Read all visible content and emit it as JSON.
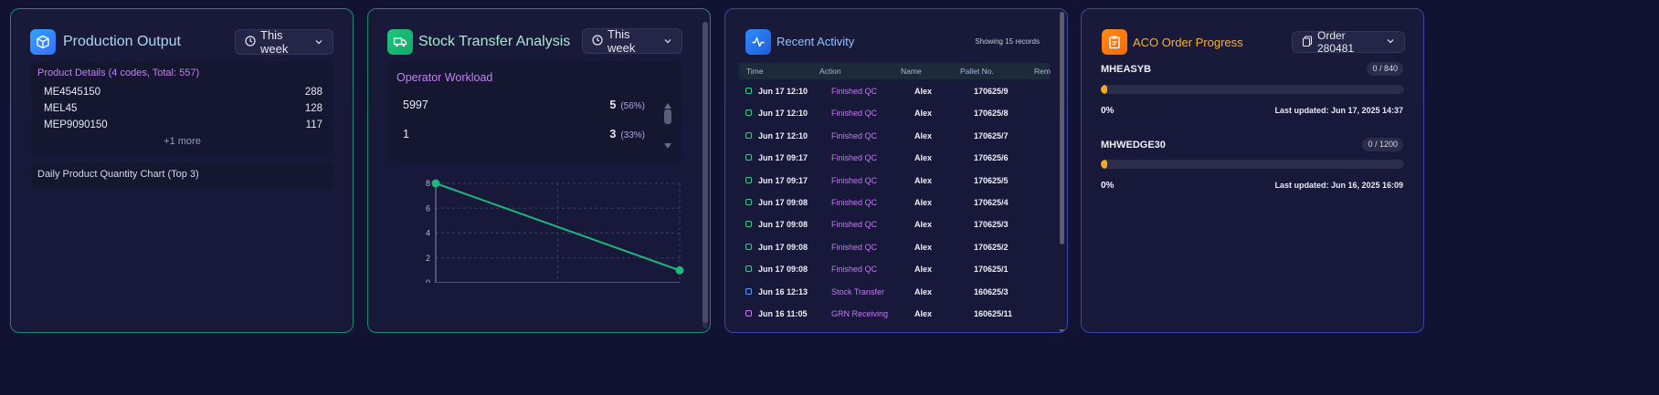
{
  "colors": {
    "background": "#121232",
    "green_border": "#1f8a6b",
    "blue_border": "#3a46a8",
    "accent_purple": "#c27cf0",
    "line_green": "#1fb57d",
    "progress_orange": "#f5a623"
  },
  "production_output": {
    "title": "Production Output",
    "icon": "cube-icon",
    "period_select": "This week",
    "product_details": {
      "title": "Product Details (4 codes, Total: 557)",
      "rows": [
        {
          "code": "ME4545150",
          "qty": "288"
        },
        {
          "code": "MEL45",
          "qty": "128"
        },
        {
          "code": "MEP9090150",
          "qty": "117"
        }
      ],
      "more": "+1 more"
    },
    "daily_chart_label": "Daily Product Quantity Chart (Top 3)"
  },
  "stock_transfer": {
    "title": "Stock Transfer Analysis",
    "icon": "truck-icon",
    "period_select": "This week",
    "operator_workload": {
      "title": "Operator Workload",
      "rows": [
        {
          "operator": "5997",
          "count": "5",
          "pct": "(56%)"
        },
        {
          "operator": "1",
          "count": "3",
          "pct": "(33%)"
        }
      ]
    },
    "chart_data": {
      "type": "line",
      "x": [
        0,
        1
      ],
      "y": [
        8,
        1
      ],
      "ylim": [
        0,
        8
      ],
      "yticks": [
        "0",
        "2",
        "4",
        "6",
        "8"
      ],
      "grid": true
    }
  },
  "recent_activity": {
    "title": "Recent Activity",
    "icon": "activity-icon",
    "showing": "Showing 15 records",
    "columns": [
      "Time",
      "Action",
      "Name",
      "Pallet No.",
      "Rem"
    ],
    "rows": [
      {
        "time": "Jun 17 12:10",
        "action": "Finished QC",
        "name": "Alex",
        "pallet": "170625/9",
        "icon": "clipboard-icon",
        "icon_color": "#3ec98a"
      },
      {
        "time": "Jun 17 12:10",
        "action": "Finished QC",
        "name": "Alex",
        "pallet": "170625/8",
        "icon": "clipboard-icon",
        "icon_color": "#3ec98a"
      },
      {
        "time": "Jun 17 12:10",
        "action": "Finished QC",
        "name": "Alex",
        "pallet": "170625/7",
        "icon": "clipboard-icon",
        "icon_color": "#3ec98a"
      },
      {
        "time": "Jun 17 09:17",
        "action": "Finished QC",
        "name": "Alex",
        "pallet": "170625/6",
        "icon": "clipboard-icon",
        "icon_color": "#3ec98a"
      },
      {
        "time": "Jun 17 09:17",
        "action": "Finished QC",
        "name": "Alex",
        "pallet": "170625/5",
        "icon": "clipboard-icon",
        "icon_color": "#3ec98a"
      },
      {
        "time": "Jun 17 09:08",
        "action": "Finished QC",
        "name": "Alex",
        "pallet": "170625/4",
        "icon": "clipboard-icon",
        "icon_color": "#3ec98a"
      },
      {
        "time": "Jun 17 09:08",
        "action": "Finished QC",
        "name": "Alex",
        "pallet": "170625/3",
        "icon": "clipboard-icon",
        "icon_color": "#3ec98a"
      },
      {
        "time": "Jun 17 09:08",
        "action": "Finished QC",
        "name": "Alex",
        "pallet": "170625/2",
        "icon": "clipboard-icon",
        "icon_color": "#3ec98a"
      },
      {
        "time": "Jun 17 09:08",
        "action": "Finished QC",
        "name": "Alex",
        "pallet": "170625/1",
        "icon": "clipboard-icon",
        "icon_color": "#3ec98a"
      },
      {
        "time": "Jun 16 12:13",
        "action": "Stock Transfer",
        "name": "Alex",
        "pallet": "160625/3",
        "icon": "truck-icon",
        "icon_color": "#5aa0ff"
      },
      {
        "time": "Jun 16 11:05",
        "action": "GRN Receiving",
        "name": "Alex",
        "pallet": "160625/11",
        "icon": "document-icon",
        "icon_color": "#c27cf0"
      }
    ]
  },
  "aco_progress": {
    "title": "ACO Order Progress",
    "icon": "clipboard-icon",
    "order_select": "Order 280481",
    "orders": [
      {
        "code": "MHEASYB",
        "badge": "0 / 840",
        "progress": 0.0,
        "pct": "0%",
        "updated": "Last updated: Jun 17, 2025 14:37"
      },
      {
        "code": "MHWEDGE30",
        "badge": "0 / 1200",
        "progress": 0.0,
        "pct": "0%",
        "updated": "Last updated: Jun 16, 2025 16:09"
      }
    ]
  }
}
